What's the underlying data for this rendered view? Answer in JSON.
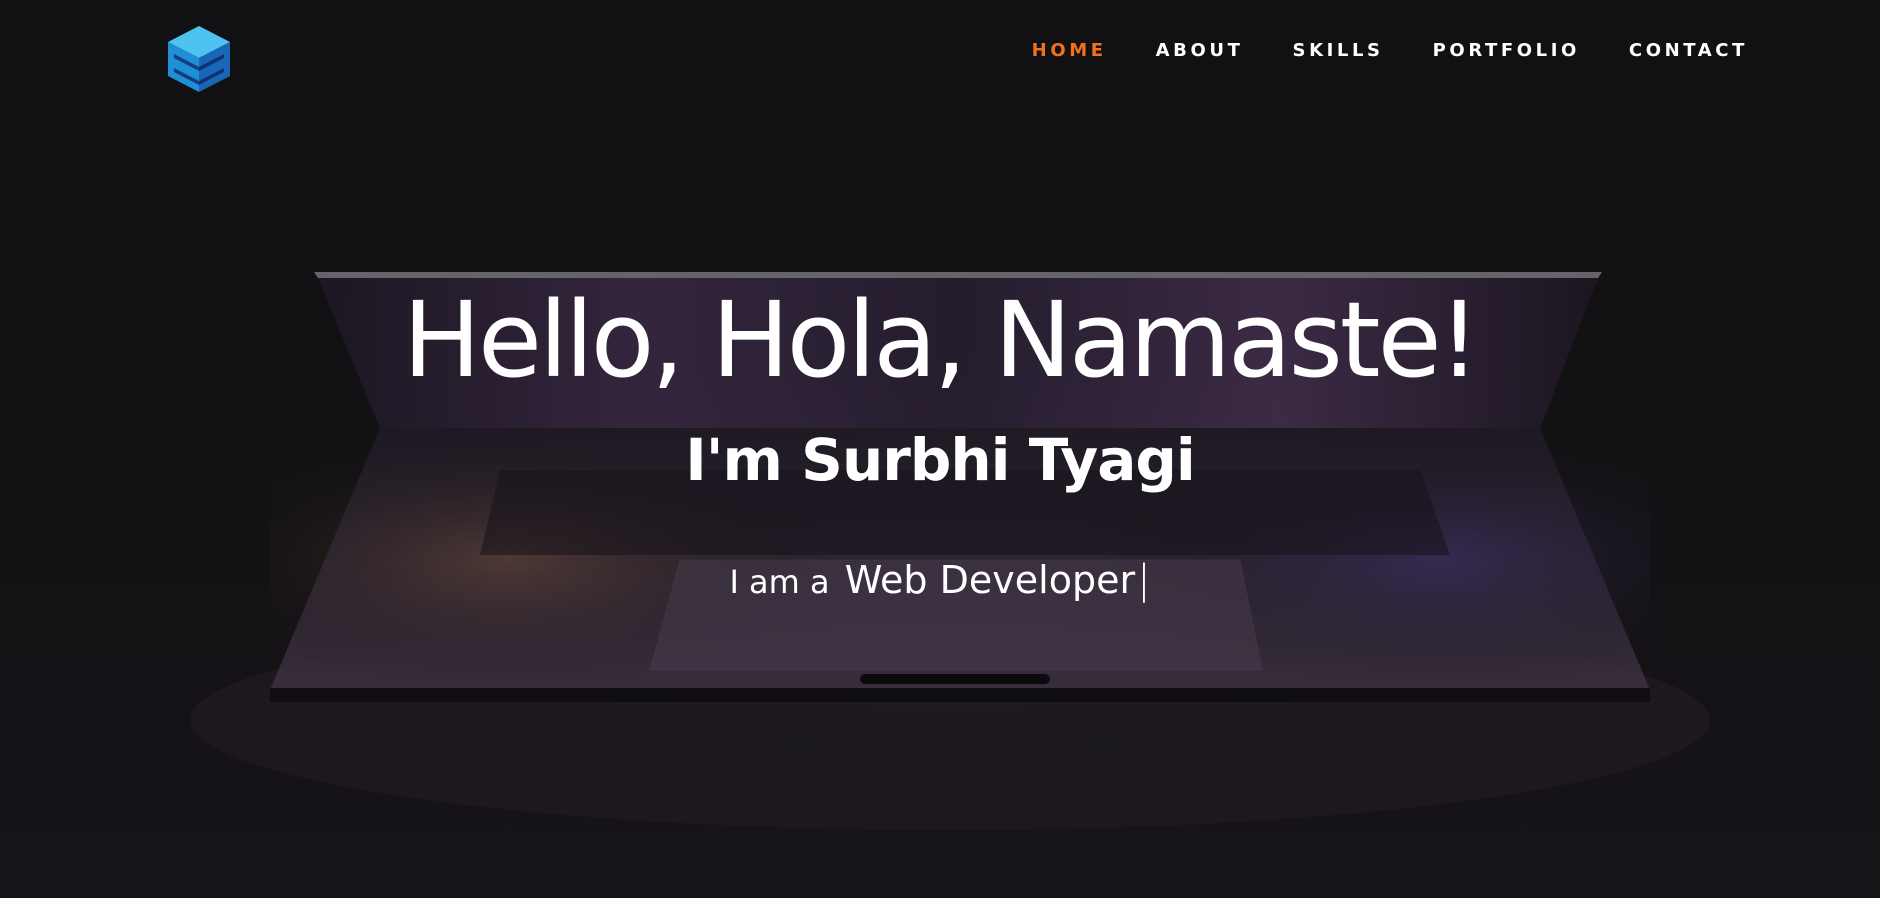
{
  "nav": {
    "items": [
      {
        "label": "HOME",
        "active": true
      },
      {
        "label": "ABOUT",
        "active": false
      },
      {
        "label": "SKILLS",
        "active": false
      },
      {
        "label": "PORTFOLIO",
        "active": false
      },
      {
        "label": "CONTACT",
        "active": false
      }
    ],
    "active_color": "#f0711f"
  },
  "hero": {
    "headline": "Hello, Hola, Namaste!",
    "name": "I'm Surbhi Tyagi",
    "role_prefix": "I am a",
    "role_typed": "Web Developer",
    "cursor": "|"
  },
  "colors": {
    "background": "#121113",
    "text": "#ffffff",
    "logo_primary": "#29a8e0",
    "logo_secondary": "#1c6fc4"
  }
}
